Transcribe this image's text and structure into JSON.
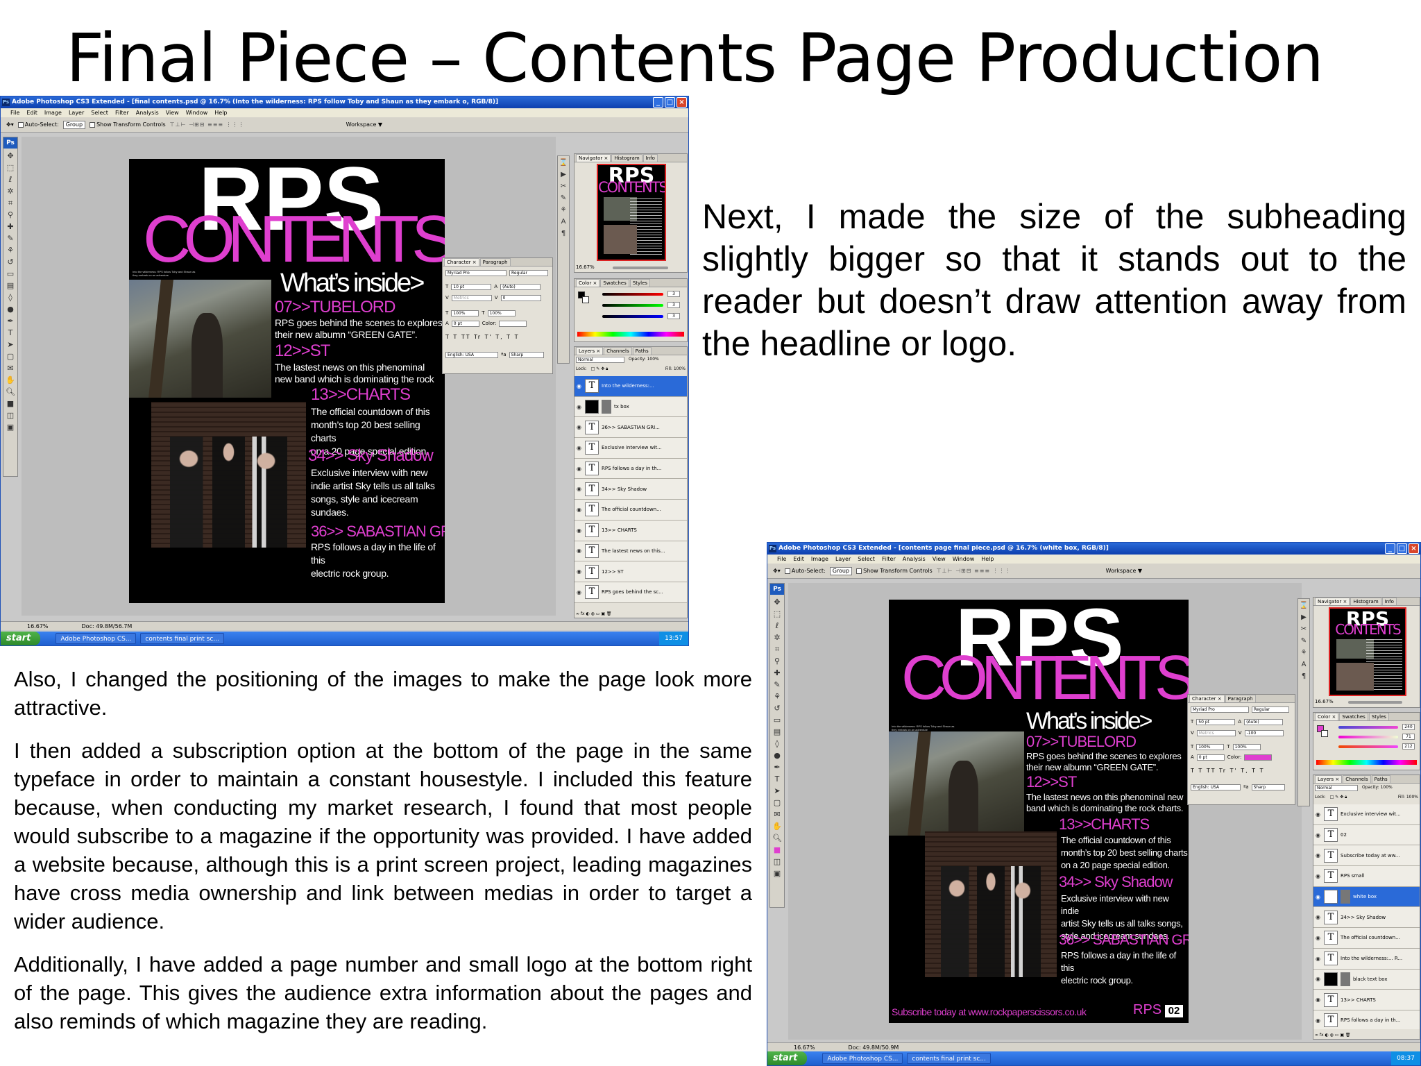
{
  "slide": {
    "title": "Final Piece – Contents Page Production",
    "text_right": "Next, I made the size of the subheading slightly bigger so that it stands out to the reader but doesn’t draw attention away from the headline or logo.",
    "paragraphs": [
      "Also, I changed the positioning of the images to make the page look more attractive.",
      "I then added a subscription option at the bottom of the page in the same typeface in order to maintain a constant housestyle. I included this feature because, when conducting my market research, I found that most people would subscribe to a magazine if the opportunity was provided. I have added a website because, although this is a print screen project, leading magazines have cross media ownership and link between medias in order to target a wider audience.",
      "Additionally, I have added a page number and small logo at the bottom right of the page. This gives the audience extra information about the pages and also reminds of which magazine they are reading."
    ]
  },
  "menu": [
    "File",
    "Edit",
    "Image",
    "Layer",
    "Select",
    "Filter",
    "Analysis",
    "View",
    "Window",
    "Help"
  ],
  "options_bar": {
    "auto_select": "Auto-Select:",
    "group": "Group",
    "show_transform": "Show Transform Controls",
    "workspace": "Workspace ▼"
  },
  "magazine": {
    "logo": "RPS",
    "contents": "CONTENTS",
    "whats_inside": "What’s inside>",
    "tiny_note": "Into the wilderness: RPS follow Toby and Shaun as they embark on an adventure",
    "items": [
      {
        "head": "07>>TUBELORD",
        "body": "RPS goes behind the scenes to explores\ntheir new albumn “GREEN GATE”."
      },
      {
        "head": "12>>ST",
        "body": "The lastest news on this phenominal\nnew band which is dominating the rock"
      },
      {
        "head": "13>>CHARTS",
        "body": "The official countdown of this\nmonth’s top 20 best selling charts\non a 20 page special edition."
      },
      {
        "head": "34>> Sky Shadow",
        "body": "Exclusive interview with new\nindie artist Sky tells us all talks\nsongs, style and icecream\nsundaes."
      },
      {
        "head": "36>> SABASTIAN GRIPS",
        "body": "RPS follows a day in the life of this\nelectric rock group."
      }
    ],
    "items_b": [
      {
        "head": "07>>TUBELORD",
        "body": "RPS goes behind the scenes to explores\ntheir new albumn “GREEN GATE”."
      },
      {
        "head": "12>>ST",
        "body": "The lastest news on this phenominal new\nband which is dominating the rock charts."
      },
      {
        "head": "13>>CHARTS",
        "body": "The official countdown of this\nmonth’s top 20 best selling charts\non a 20 page special edition."
      },
      {
        "head": "34>> Sky Shadow",
        "body": "Exclusive interview with new indie\nartist Sky tells us all talks songs,\nstyle and icecream sundaes."
      },
      {
        "head": "36>> SABASTIAN GRIPS",
        "body": "RPS follows a day in the life of this\nelectric rock group."
      }
    ],
    "subscribe": "Subscribe today at www.rockpaperscissors.co.uk",
    "small_logo": "RPS",
    "page_number": "02"
  },
  "window_a": {
    "title": "Adobe Photoshop CS3 Extended - [final contents.psd @ 16.7% (Into the wilderness: RPS follow Toby and Shaun as they embark o, RGB/8)]",
    "zoom": "16.67%",
    "doc": "Doc: 49.8M/56.7M",
    "task_ps": "Adobe Photoshop CS...",
    "task_doc": "contents final print sc...",
    "clock": "13:57",
    "character": {
      "font": "Myriad Pro",
      "style": "Regular",
      "size": "10 pt",
      "leading": "(Auto)",
      "kerning": "Metrics",
      "tracking": "0",
      "vscale": "100%",
      "hscale": "100%",
      "baseline": "0 pt",
      "color_label": "Color:",
      "lang": "English: USA",
      "aa": "Sharp"
    },
    "color_values": [
      "3",
      "3",
      "3"
    ],
    "layer_blend": "Normal",
    "opacity": "Opacity: 100%",
    "fill": "Fill: 100%",
    "lock": "Lock:",
    "layers": [
      {
        "name": "Into the wilderness:...",
        "type": "T",
        "selected": true
      },
      {
        "name": "tx box",
        "type": "box",
        "selected": false
      },
      {
        "name": "36>> SABASTIAN GRI...",
        "type": "T",
        "selected": false
      },
      {
        "name": "Exclusive interview wit...",
        "type": "T",
        "selected": false
      },
      {
        "name": "RPS follows a day in th...",
        "type": "T",
        "selected": false
      },
      {
        "name": "34>> Sky Shadow",
        "type": "T",
        "selected": false
      },
      {
        "name": "The official countdown...",
        "type": "T",
        "selected": false
      },
      {
        "name": "13>> CHARTS",
        "type": "T",
        "selected": false
      },
      {
        "name": "The lastest news on this...",
        "type": "T",
        "selected": false
      },
      {
        "name": "12>> ST",
        "type": "T",
        "selected": false
      },
      {
        "name": "RPS goes behind the sc...",
        "type": "T",
        "selected": false
      }
    ]
  },
  "window_b": {
    "title": "Adobe Photoshop CS3 Extended - [contents page final piece.psd @ 16.7% (white box, RGB/8)]",
    "zoom": "16.67%",
    "doc": "Doc: 49.8M/50.9M",
    "task_ps": "Adobe Photoshop CS...",
    "task_doc": "contents final print sc...",
    "clock": "08:37",
    "character": {
      "font": "Myriad Pro",
      "style": "Regular",
      "size": "50 pt",
      "leading": "(Auto)",
      "kerning": "Metrics",
      "tracking": "-100",
      "vscale": "100%",
      "hscale": "100%",
      "baseline": "0 pt",
      "color_label": "Color:",
      "lang": "English: USA",
      "aa": "Sharp"
    },
    "color_values": [
      "240",
      "71",
      "212"
    ],
    "layer_blend": "Normal",
    "opacity": "Opacity: 100%",
    "fill": "Fill: 100%",
    "lock": "Lock:",
    "layers": [
      {
        "name": "Exclusive interview wit...",
        "type": "T",
        "selected": false
      },
      {
        "name": "02",
        "type": "T",
        "selected": false
      },
      {
        "name": "Subscribe today at ww...",
        "type": "T",
        "selected": false
      },
      {
        "name": "RPS small",
        "type": "T",
        "selected": false
      },
      {
        "name": "white box",
        "type": "box",
        "selected": true
      },
      {
        "name": "34>> Sky Shadow",
        "type": "T",
        "selected": false
      },
      {
        "name": "The official countdown...",
        "type": "T",
        "selected": false
      },
      {
        "name": "Into the wilderness:... R...",
        "type": "T",
        "selected": false
      },
      {
        "name": "black text box",
        "type": "blk",
        "selected": false
      },
      {
        "name": "13>> CHARTS",
        "type": "T",
        "selected": false
      },
      {
        "name": "RPS follows a day in th...",
        "type": "T",
        "selected": false
      }
    ]
  },
  "panel_tabs": {
    "navigator": [
      "Navigator ×",
      "Histogram",
      "Info"
    ],
    "color": [
      "Color ×",
      "Swatches",
      "Styles"
    ],
    "layers": [
      "Layers ×",
      "Channels",
      "Paths"
    ],
    "character": [
      "Character ×",
      "Paragraph"
    ]
  },
  "taskbar": {
    "start": "start"
  },
  "colors": {
    "magenta": "#df3fcf",
    "xp_blue": "#2a6ad8",
    "ps_grey": "#c9c9c9"
  }
}
